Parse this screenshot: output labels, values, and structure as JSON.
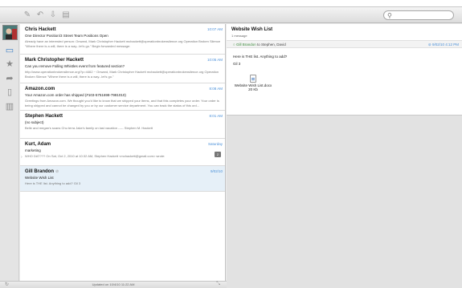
{
  "toolbar": {
    "buttons": [
      "compose-icon",
      "reply-icon",
      "archive-icon",
      "filter-icon"
    ],
    "search_placeholder": ""
  },
  "sidebar": {
    "items": [
      "inbox-icon",
      "star-icon",
      "sent-icon",
      "document-icon",
      "trash-icon"
    ]
  },
  "messages": [
    {
      "from": "Chris Hackett",
      "date": "10:07 AM",
      "subject": "One Director Position/3 Street Team Positions Open",
      "preview": "Already have an interested person: Onward, Mark Christopher Hackett mchackett@operationbrokensilence.org Operation Broken Silence \"Where there is a will, there is a way...let's go.\" Begin forwarded message:"
    },
    {
      "from": "Mark Christopher Hackett",
      "date": "10:05 AM",
      "subject": "Can you remove Falling Whistles event from featured section?",
      "preview": "http://www.operationbrokensilence.org/?p=4462 ~ Onward, Mark Christopher Hackett mchackett@operationbrokensilence.org Operation Broken Silence \"Where there is a will, there is a way...let's go.\""
    },
    {
      "from": "Amazon.com",
      "date": "8:08 AM",
      "subject": "Your Amazon.com order has shipped (#103-5751698-7981010)",
      "preview": "Greetings from Amazon.com. We thought you'd like to know that we shipped your items, and that this completes your order. Your order is being shipped and cannot be changed by you or by our customer service department. You can track the status of this ord..."
    },
    {
      "from": "Stephen Hackett",
      "date": "8:01 AM",
      "subject": "(no subject)",
      "preview": "Belle and megan's scans Chu terra Jake's family on last vacation ----- Stephen M. Hackett"
    },
    {
      "from": "Kurt, Adam",
      "date": "Saturday",
      "subject": "marketing",
      "preview": "WHO DAT??? On Sat, Oct 2, 2010 at 10:32 AM, Stephen Hackett <mchackett@gmail.com> wrote:",
      "badge": "2"
    },
    {
      "from": "Gill Brandon",
      "date": "9/02/10",
      "subject": "Website Wish List",
      "preview": "Here is THE list. Anything to add? Gil 3"
    }
  ],
  "status": {
    "updated": "Updated on 10/4/10 11:22 AM"
  },
  "reader": {
    "title": "Website Wish List",
    "count": "1 message",
    "sender": "Gill Brandon",
    "to_text": " to Stephen, David",
    "date": "9/02/10 4:12 PM",
    "body_line1": "Here is THE list. Anything to add?",
    "body_line2": "Gil 3",
    "attachment_name": "Website Wish List.docx",
    "attachment_size": "20 Kb"
  }
}
